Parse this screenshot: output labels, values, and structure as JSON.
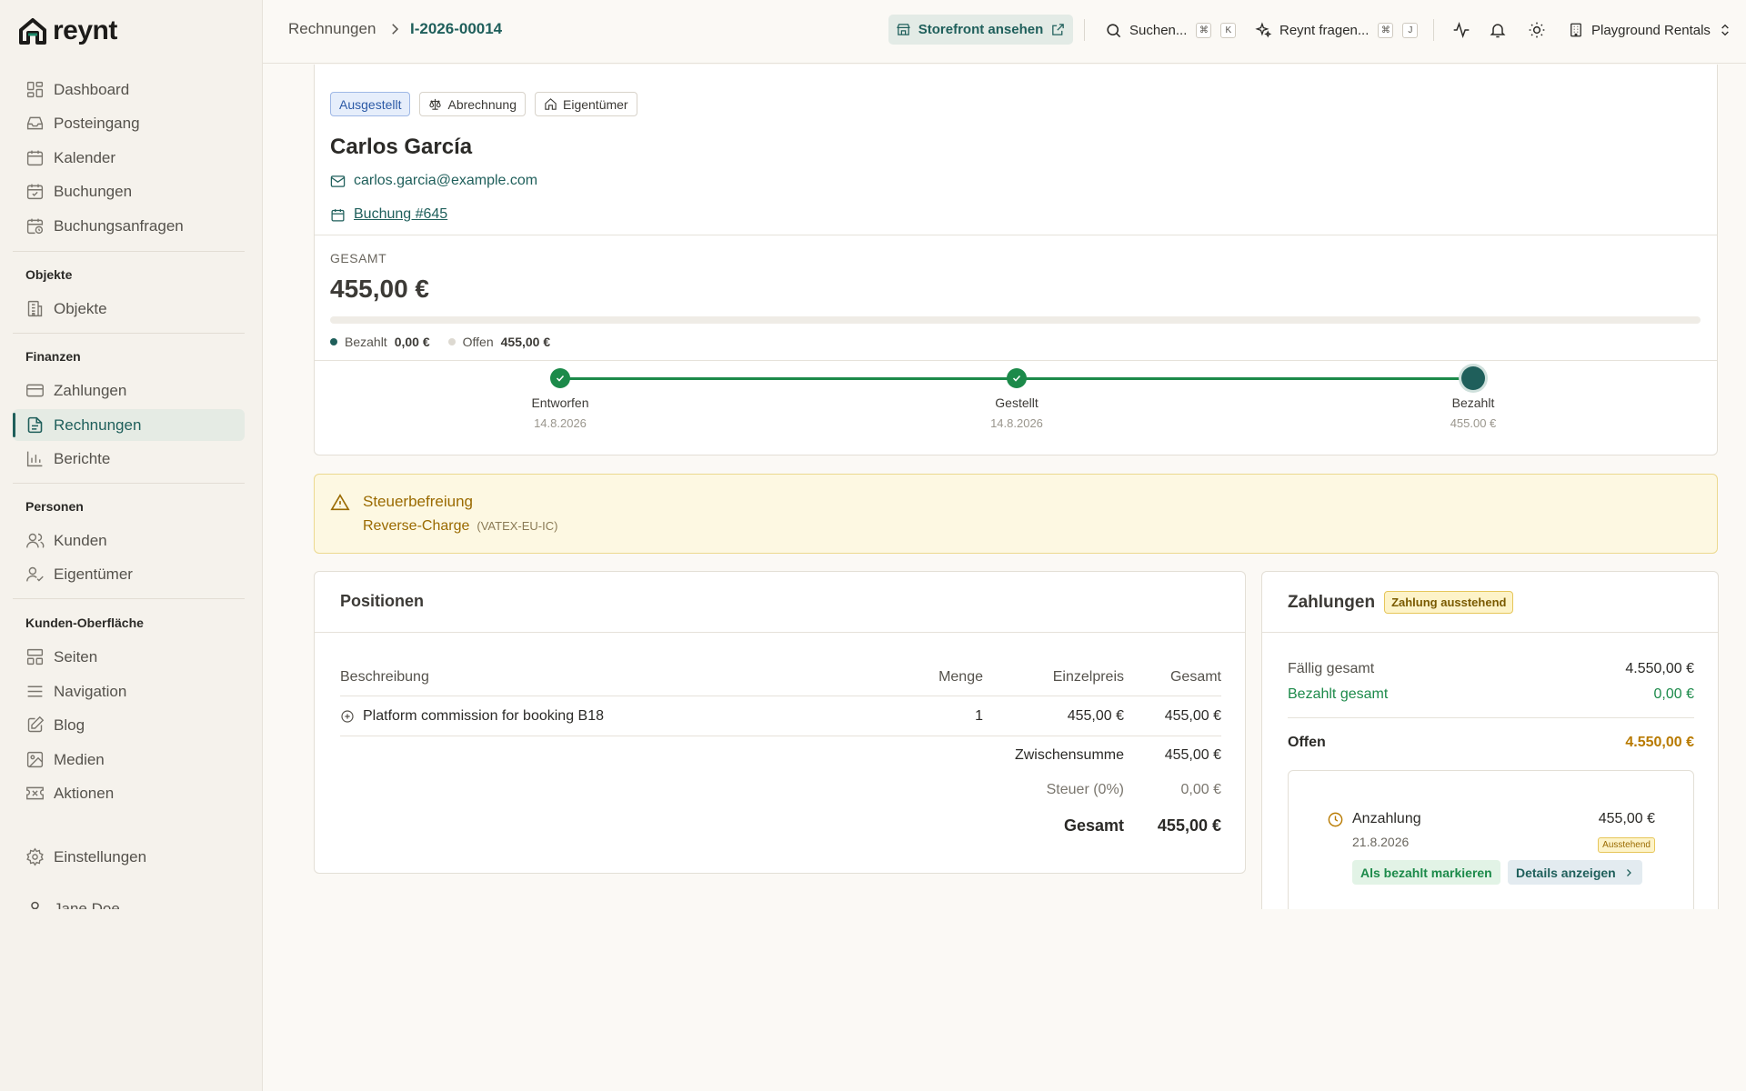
{
  "brand": {
    "name": "reynt"
  },
  "sidebar": {
    "top_items": [
      {
        "label": "Dashboard",
        "icon": "dashboard-icon"
      },
      {
        "label": "Posteingang",
        "icon": "inbox-icon"
      },
      {
        "label": "Kalender",
        "icon": "calendar-icon"
      },
      {
        "label": "Buchungen",
        "icon": "calendar-check-icon"
      },
      {
        "label": "Buchungsanfragen",
        "icon": "calendar-clock-icon"
      }
    ],
    "sections": [
      {
        "title": "Objekte",
        "items": [
          {
            "label": "Objekte",
            "icon": "building-icon"
          }
        ]
      },
      {
        "title": "Finanzen",
        "items": [
          {
            "label": "Zahlungen",
            "icon": "credit-card-icon"
          },
          {
            "label": "Rechnungen",
            "icon": "file-text-icon",
            "active": true
          },
          {
            "label": "Berichte",
            "icon": "bar-chart-icon"
          }
        ]
      },
      {
        "title": "Personen",
        "items": [
          {
            "label": "Kunden",
            "icon": "users-icon"
          },
          {
            "label": "Eigentümer",
            "icon": "user-check-icon"
          }
        ]
      },
      {
        "title": "Kunden-Oberfläche",
        "items": [
          {
            "label": "Seiten",
            "icon": "layout-icon"
          },
          {
            "label": "Navigation",
            "icon": "menu-icon"
          },
          {
            "label": "Blog",
            "icon": "edit-icon"
          },
          {
            "label": "Medien",
            "icon": "image-icon"
          },
          {
            "label": "Aktionen",
            "icon": "ticket-icon"
          }
        ]
      }
    ],
    "settings_label": "Einstellungen",
    "user_name": "Jane Doe"
  },
  "header": {
    "breadcrumb_parent": "Rechnungen",
    "breadcrumb_current": "I-2026-00014",
    "storefront_label": "Storefront ansehen",
    "search_label": "Suchen...",
    "search_kbd": [
      "⌘",
      "K"
    ],
    "ask_label": "Reynt fragen...",
    "ask_kbd": [
      "⌘",
      "J"
    ],
    "org_name": "Playground Rentals"
  },
  "invoice": {
    "tags": [
      "Ausgestellt",
      "Abrechnung",
      "Eigentümer"
    ],
    "customer_name": "Carlos García",
    "email": "carlos.garcia@example.com",
    "booking_link": "Buchung #645",
    "total_label": "GESAMT",
    "total_value": "455,00 €",
    "paid_fraction": 0,
    "paid_label": "Bezahlt",
    "paid_value": "0,00 €",
    "open_label": "Offen",
    "open_value": "455,00 €",
    "timeline": [
      {
        "label": "Entworfen",
        "sub": "14.8.2026",
        "done": true
      },
      {
        "label": "Gestellt",
        "sub": "14.8.2026",
        "done": true
      },
      {
        "label": "Bezahlt",
        "sub": "455.00 €",
        "done": false
      }
    ]
  },
  "tax_notice": {
    "title": "Steuerbefreiung",
    "reason": "Reverse-Charge",
    "code": "(VATEX-EU-IC)"
  },
  "positions": {
    "title": "Positionen",
    "columns": [
      "Beschreibung",
      "Menge",
      "Einzelpreis",
      "Gesamt"
    ],
    "rows": [
      {
        "description": "Platform commission for booking B18",
        "qty": "1",
        "unit_price": "455,00 €",
        "total": "455,00 €"
      }
    ],
    "subtotal_label": "Zwischensumme",
    "subtotal_value": "455,00 €",
    "tax_label": "Steuer (0%)",
    "tax_value": "0,00 €",
    "grand_label": "Gesamt",
    "grand_value": "455,00 €"
  },
  "payments": {
    "title": "Zahlungen",
    "status_badge": "Zahlung ausstehend",
    "due_label": "Fällig gesamt",
    "due_value": "4.550,00 €",
    "paid_label": "Bezahlt gesamt",
    "paid_value": "0,00 €",
    "open_label": "Offen",
    "open_value": "4.550,00 €",
    "entry": {
      "title": "Anzahlung",
      "date": "21.8.2026",
      "amount": "455,00 €",
      "status": "Ausstehend",
      "mark_paid_label": "Als bezahlt markieren",
      "details_label": "Details anzeigen"
    }
  },
  "colors": {
    "accent": "#1f5f5b",
    "success": "#1c8a4a",
    "warning": "#9a6a00",
    "sidebar_bg": "#f5f2ec",
    "page_bg": "#fbf9f5"
  }
}
